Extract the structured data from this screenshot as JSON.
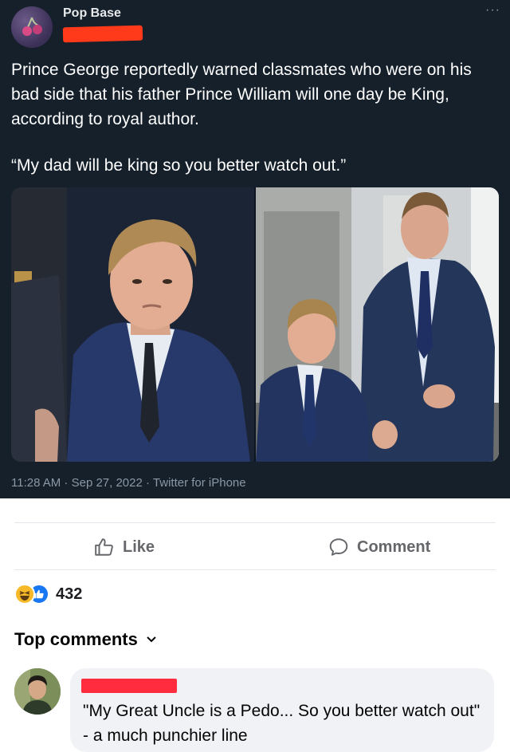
{
  "tweet": {
    "account_name": "Pop Base",
    "more_label": "···",
    "text": "Prince George reportedly warned classmates who were on his bad side that his father Prince William will one day be King, according to royal author.",
    "quote": "“My dad will be king so you better watch out.”",
    "meta": "11:28 AM · Sep 27, 2022 · Twitter for iPhone",
    "colors": {
      "background": "#15202b",
      "handle_redaction": "#ff3a1a"
    }
  },
  "post_actions": {
    "like_label": "Like",
    "comment_label": "Comment",
    "icons": {
      "like": "thumbs-up-icon",
      "comment": "speech-bubble-icon"
    }
  },
  "reactions": {
    "count": "432",
    "icons": [
      "haha-icon",
      "like-reaction-icon"
    ]
  },
  "comments_section": {
    "title": "Top comments",
    "dropdown_icon": "chevron-down-icon",
    "comments": [
      {
        "text": "\"My Great Uncle is a Pedo... So you better watch out\" - a much punchier line",
        "name_redaction_color": "#ff2b3e"
      }
    ]
  }
}
